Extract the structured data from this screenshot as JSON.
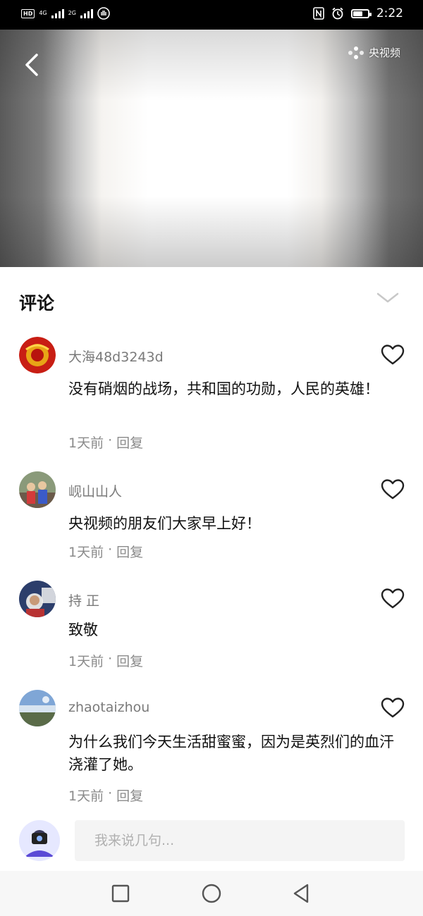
{
  "status_bar": {
    "network_1": "4G",
    "network_2": "2G",
    "time": "2:22",
    "battery_level": 0.6
  },
  "video": {
    "watermark": "央视频"
  },
  "comments": {
    "title": "评论",
    "items": [
      {
        "username": "大海48d3243d",
        "content": "没有硝烟的战场，共和国的功勋，人民的英雄！",
        "time": "1天前",
        "separator": "·",
        "reply": "回复"
      },
      {
        "username": "岘山山人",
        "content": "央视频的朋友们大家早上好！",
        "time": "1天前",
        "separator": "·",
        "reply": "回复"
      },
      {
        "username": "持 正",
        "content": "致敬",
        "time": "1天前",
        "separator": "·",
        "reply": "回复"
      },
      {
        "username": "zhaotaizhou",
        "content": "为什么我们今天生活甜蜜蜜，因为是英烈们的血汗浇灌了她。",
        "time": "1天前",
        "separator": "·",
        "reply": "回复"
      }
    ]
  },
  "input": {
    "placeholder": "我来说几句..."
  },
  "colors": {
    "accent": "#111111",
    "secondary_text": "#8a8a8a",
    "status_bar_bg": "#000000"
  }
}
